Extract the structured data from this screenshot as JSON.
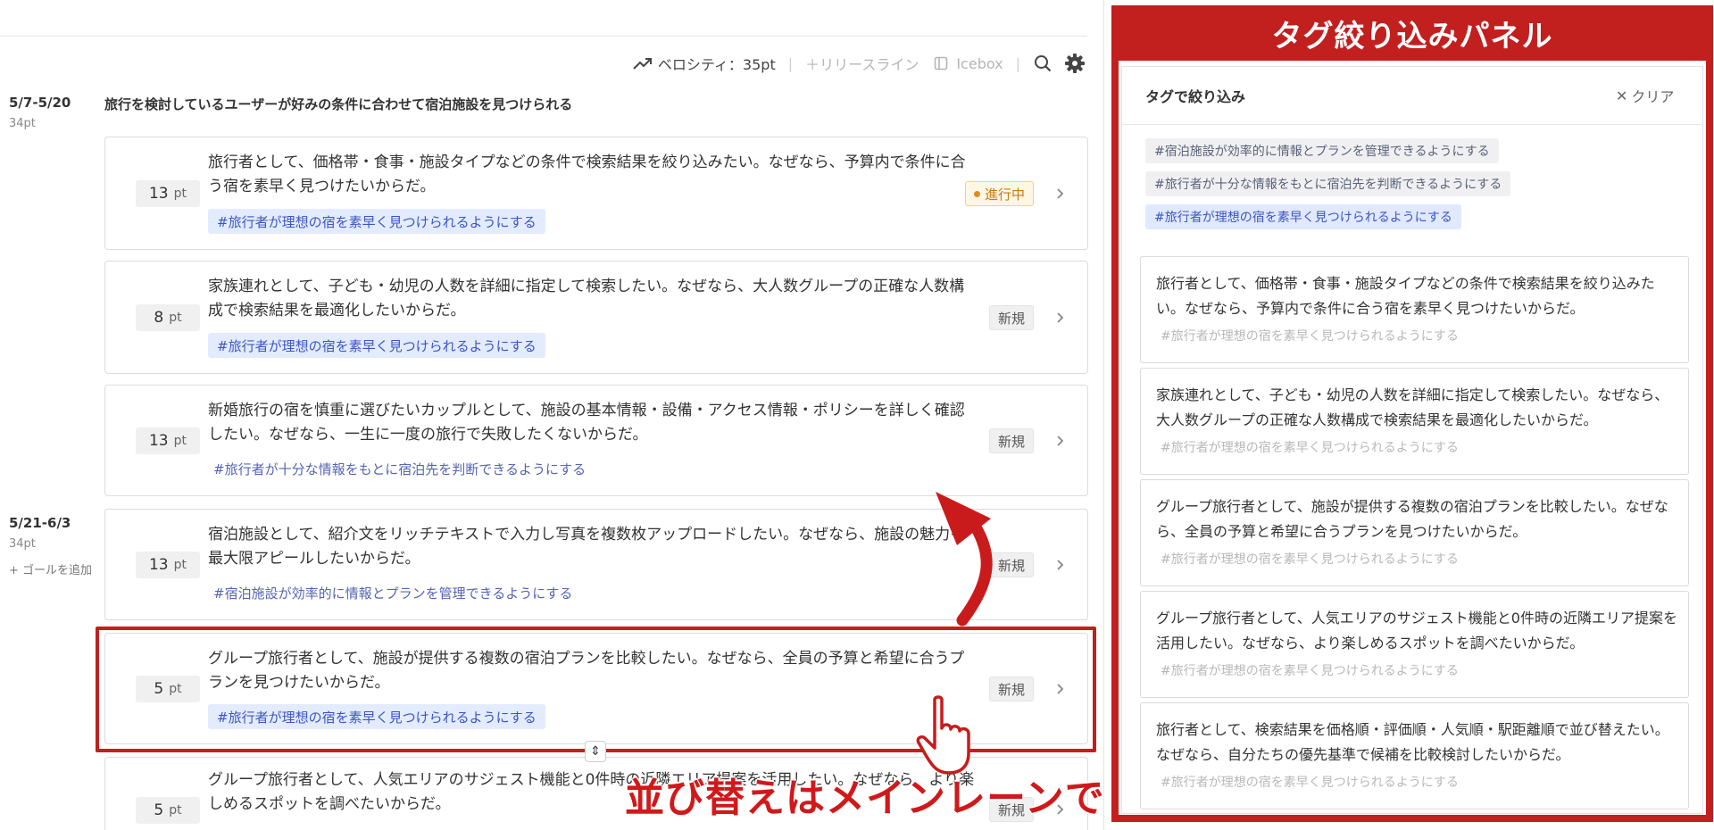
{
  "toolbar": {
    "velocity_label": "ベロシティ：35pt",
    "release_line_label": "＋リリースライン",
    "icebox_label": "Icebox",
    "separator": "|"
  },
  "periods": [
    {
      "range": "5/7-5/20",
      "points": "34pt",
      "goal": "旅行を検討しているユーザーが好みの条件に合わせて宿泊施設を見つけられる"
    },
    {
      "range": "5/21-6/3",
      "points": "34pt",
      "add_goal": "+ ゴールを追加"
    }
  ],
  "stories": [
    {
      "points": "13",
      "unit": "pt",
      "text": "旅行者として、価格帯・食事・施設タイプなどの条件で検索結果を絞り込みたい。なぜなら、予算内で条件に合う宿を素早く見つけたいからだ。",
      "tag": "#旅行者が理想の宿を素早く見つけられるようにする",
      "status": "進行中"
    },
    {
      "points": "8",
      "unit": "pt",
      "text": "家族連れとして、子ども・幼児の人数を詳細に指定して検索したい。なぜなら、大人数グループの正確な人数構成で検索結果を最適化したいからだ。",
      "tag": "#旅行者が理想の宿を素早く見つけられるようにする",
      "status": "新規"
    },
    {
      "points": "13",
      "unit": "pt",
      "text": "新婚旅行の宿を慎重に選びたいカップルとして、施設の基本情報・設備・アクセス情報・ポリシーを詳しく確認したい。なぜなら、一生に一度の旅行で失敗したくないからだ。",
      "tag": "#旅行者が十分な情報をもとに宿泊先を判断できるようにする",
      "status": "新規"
    },
    {
      "points": "13",
      "unit": "pt",
      "text": "宿泊施設として、紹介文をリッチテキストで入力し写真を複数枚アップロードしたい。なぜなら、施設の魅力を最大限アピールしたいからだ。",
      "tag": "#宿泊施設が効率的に情報とプランを管理できるようにする",
      "status": "新規"
    },
    {
      "points": "5",
      "unit": "pt",
      "text": "グループ旅行者として、施設が提供する複数の宿泊プランを比較したい。なぜなら、全員の予算と希望に合うプランを見つけたいからだ。",
      "tag": "#旅行者が理想の宿を素早く見つけられるようにする",
      "status": "新規"
    },
    {
      "points": "5",
      "unit": "pt",
      "text": "グループ旅行者として、人気エリアのサジェスト機能と0件時の近隣エリア提案を活用したい。なぜなら、より楽しめるスポットを調べたいからだ。",
      "status": "新規"
    }
  ],
  "annotation": "並び替えはメインレーンで",
  "panel": {
    "header": "タグ絞り込みパネル",
    "title": "タグで絞り込み",
    "clear_label": "クリア",
    "filter_tags": [
      "#宿泊施設が効率的に情報とプランを管理できるようにする",
      "#旅行者が十分な情報をもとに宿泊先を判断できるようにする",
      "#旅行者が理想の宿を素早く見つけられるようにする"
    ],
    "cards": [
      {
        "text": "旅行者として、価格帯・食事・施設タイプなどの条件で検索結果を絞り込みたい。なぜなら、予算内で条件に合う宿を素早く見つけたいからだ。",
        "tag": "#旅行者が理想の宿を素早く見つけられるようにする"
      },
      {
        "text": "家族連れとして、子ども・幼児の人数を詳細に指定して検索したい。なぜなら、大人数グループの正確な人数構成で検索結果を最適化したいからだ。",
        "tag": "#旅行者が理想の宿を素早く見つけられるようにする"
      },
      {
        "text": "グループ旅行者として、施設が提供する複数の宿泊プランを比較したい。なぜなら、全員の予算と希望に合うプランを見つけたいからだ。",
        "tag": "#旅行者が理想の宿を素早く見つけられるようにする"
      },
      {
        "text": "グループ旅行者として、人気エリアのサジェスト機能と0件時の近隣エリア提案を活用したい。なぜなら、より楽しめるスポットを調べたいからだ。",
        "tag": "#旅行者が理想の宿を素早く見つけられるようにする"
      },
      {
        "text": "旅行者として、検索結果を価格順・評価順・人気順・駅距離順で並び替えたい。なぜなら、自分たちの優先基準で候補を比較検討したいからだ。",
        "tag": "#旅行者が理想の宿を素早く見つけられるようにする"
      }
    ]
  },
  "colors": {
    "annotation_red": "#c21f1f",
    "tag_highlight": "#e3ebff",
    "progress": "#e08a1e"
  }
}
